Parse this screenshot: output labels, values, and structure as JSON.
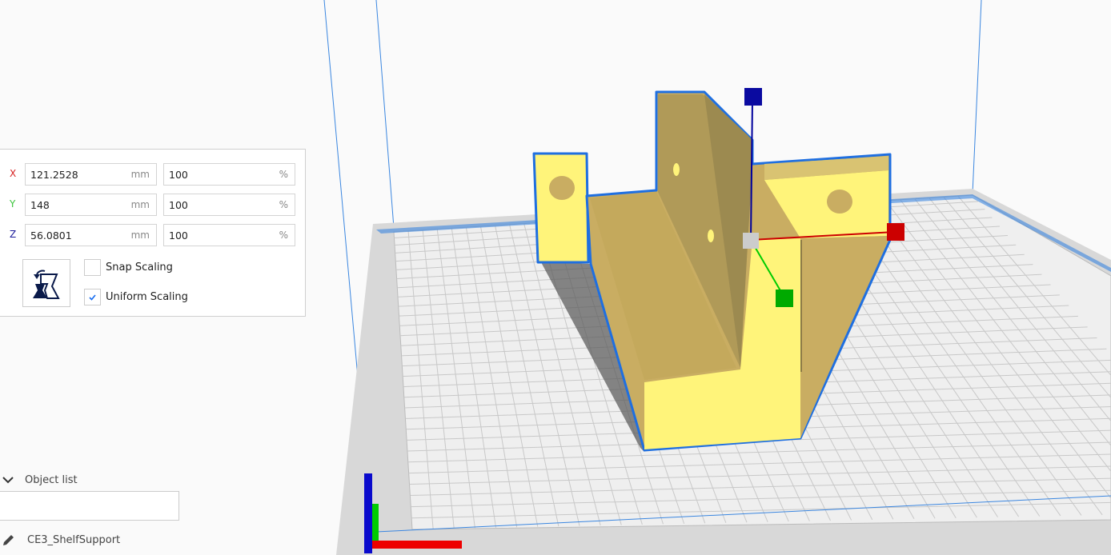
{
  "scale_panel": {
    "rows": [
      {
        "axis": "X",
        "axis_color": "#d62020",
        "size": "121.2528",
        "size_unit": "mm",
        "percent": "100",
        "percent_unit": "%"
      },
      {
        "axis": "Y",
        "axis_color": "#3cc43c",
        "size": "148",
        "size_unit": "mm",
        "percent": "100",
        "percent_unit": "%"
      },
      {
        "axis": "Z",
        "axis_color": "#1a1a9a",
        "size": "56.0801",
        "size_unit": "mm",
        "percent": "100",
        "percent_unit": "%"
      }
    ],
    "snap_scaling": {
      "label": "Snap Scaling",
      "checked": false
    },
    "uniform_scaling": {
      "label": "Uniform Scaling",
      "checked": true
    }
  },
  "object_list": {
    "header": "Object list",
    "object_name": "CE3_ShelfSupport"
  },
  "colors": {
    "model": "#fff47a",
    "model_side": "#c9ad62",
    "outline": "#1f6fe0",
    "accent": "#196ef0"
  }
}
